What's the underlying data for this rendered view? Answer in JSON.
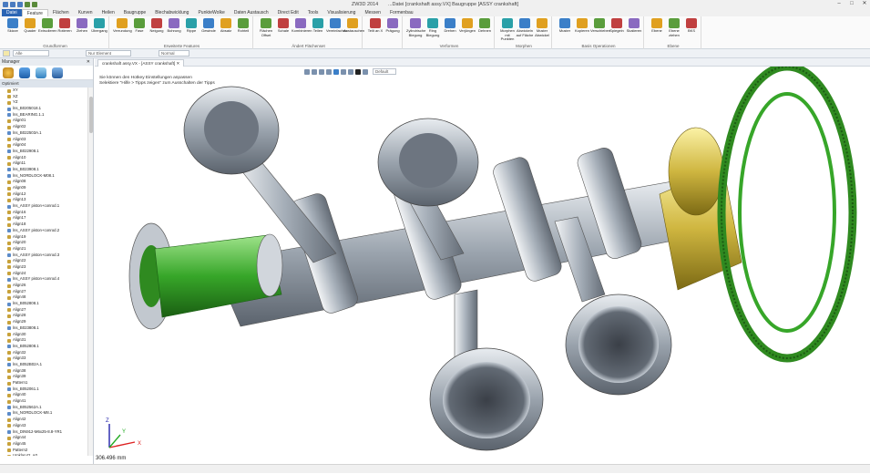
{
  "window": {
    "title": "ZW3D 2014",
    "doc_title": "...Datei [crankshaft assy.VX]  Baugruppe [ASSY crankshaft]"
  },
  "ribbon_tabs": [
    "Datei",
    "Feature",
    "Flächen",
    "Kurven",
    "Heilen",
    "Baugruppe",
    "Blechabwicklung",
    "PunkteWolke",
    "Daten Austausch",
    "Direct Edit",
    "Tools",
    "Visualisierung",
    "Messen",
    "Formenbau"
  ],
  "ribbon_groups": [
    {
      "label": "Grundformen",
      "buttons": [
        "Skizze",
        "Quader",
        "Extrudieren",
        "Rotieren",
        "Ziehen",
        "Übergang"
      ]
    },
    {
      "label": "Erweiterte Features",
      "buttons": [
        "Verrundung",
        "Fase",
        "Neigung",
        "Bohrung",
        "Rippe",
        "Gewinde",
        "Absatz",
        "Rohteil"
      ]
    },
    {
      "label": "Ändert Flächenset",
      "buttons": [
        "Flächen Offset",
        "Schale",
        "Kombinieren",
        "Teilen",
        "Vereinfachen",
        "Austauschen"
      ]
    },
    {
      "label": "",
      "buttons": [
        "Teilt an X",
        "Prägung"
      ]
    },
    {
      "label": "Verformen",
      "buttons": [
        "Zylindrische Biegung",
        "Ring Biegung",
        "Drehen",
        "Verjüngen",
        "Dehnen"
      ]
    },
    {
      "label": "Morphen",
      "buttons": [
        "Morphen mit Punkten",
        "Abwickeln auf Fläche",
        "Muster Abwickel"
      ]
    },
    {
      "label": "Basis Operationen",
      "buttons": [
        "Muster",
        "Kopieren",
        "Verschieben",
        "Spiegeln",
        "Skalieren"
      ]
    },
    {
      "label": "Ebene",
      "buttons": [
        "Ebene",
        "Ebene ziehen",
        "BKS"
      ]
    }
  ],
  "secbar": {
    "filter": "Alle",
    "element_placeholder": "Nur Element",
    "view": "Normal"
  },
  "manager": {
    "title": "Manager",
    "filter_label": "Optimiert"
  },
  "tree_items": [
    "XY",
    "XZ",
    "YZ",
    "lns_B0205018.1",
    "lns_BEARING.1.1",
    "Align01",
    "Align02",
    "lns_B022503A.1",
    "Align03",
    "Align04",
    "lns_B022908.1",
    "Align10",
    "Align11",
    "lns_B023908.1",
    "lns_NORDLOCK-M08.1",
    "Align08",
    "Align09",
    "Align12",
    "Align13",
    "lns_ASSY piston+conrod.1",
    "Align16",
    "Align17",
    "Align18",
    "lns_ASSY piston+conrod.2",
    "Align19",
    "Align20",
    "Align21",
    "lns_ASSY piston+conrod.3",
    "Align22",
    "Align23",
    "Align24",
    "lns_ASSY piston+conrod.4",
    "Align26",
    "Align27",
    "Align48",
    "lns_B052808.1",
    "Align27",
    "Align28",
    "Align29",
    "lns_B023808.1",
    "Align30",
    "Align31",
    "lns_B052808.1",
    "Align32",
    "Align33",
    "lns_B052B02A.1",
    "Align38",
    "Align39",
    "Pattern1",
    "lns_B052061.1",
    "Align40",
    "Align41",
    "lns_B052562A.1",
    "lns_NORDLOCK-M8.1",
    "Align42",
    "Align43",
    "lns_DIN912-M6x25-8.8-YR1",
    "Align44",
    "Align45",
    "Pattern2",
    "Umklan42_A0"
  ],
  "history": "Historieoperationen",
  "doc_tab": "crankshaft assy.VX - [ASSY crankshaft]",
  "viewport": {
    "tip_line1": "Sie können den Hotkey Einstellungen anpassen",
    "tip_line2": "Selektiere \"Hilfe > Tipps zeigen\" zum Ausschalten der Tipps",
    "measure": "306.496 mm",
    "default_label": "Default",
    "axis_x": "X",
    "axis_y": "Y",
    "axis_z": "Z"
  },
  "colors": {
    "accent": "#2a64b4",
    "green": "#2ea01e",
    "gold": "#c9b23a",
    "steel": "#9ea7b1"
  }
}
